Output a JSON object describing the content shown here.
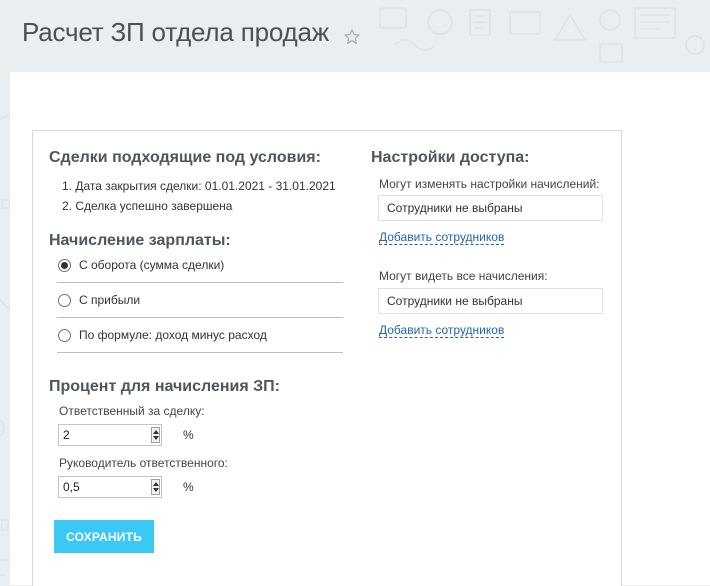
{
  "title": "Расчет ЗП отдела продаж",
  "icons": {
    "favorite": "star-outline-icon",
    "spinner_up": "caret-up-icon",
    "spinner_down": "caret-down-icon"
  },
  "conditions": {
    "heading": "Сделки подходящие под условия:",
    "items": [
      "1. Дата закрытия сделки: 01.01.2021 - 31.01.2021",
      "2. Сделка успешно завершена"
    ]
  },
  "salary": {
    "heading": "Начисление зарплаты:",
    "options": [
      {
        "label": "С оборота (сумма сделки)",
        "checked": true
      },
      {
        "label": "С прибыли",
        "checked": false
      },
      {
        "label": "По формуле: доход минус расход",
        "checked": false
      }
    ]
  },
  "percent": {
    "heading": "Процент для начисления ЗП:",
    "responsible_label": "Ответственный за сделку:",
    "responsible_value": "2",
    "manager_label": "Руководитель ответственного:",
    "manager_value": "0,5",
    "unit": "%"
  },
  "access": {
    "heading": "Настройки доступа:",
    "edit_label": "Могут изменять настройки начислений:",
    "edit_value": "Сотрудники не выбраны",
    "view_label": "Могут видеть все начисления:",
    "view_value": "Сотрудники не выбраны",
    "add_link": "Добавить сотрудников"
  },
  "save_button": "СОХРАНИТЬ",
  "colors": {
    "accent": "#3bc8f5",
    "link": "#2067b0",
    "background": "#e9eef1"
  }
}
